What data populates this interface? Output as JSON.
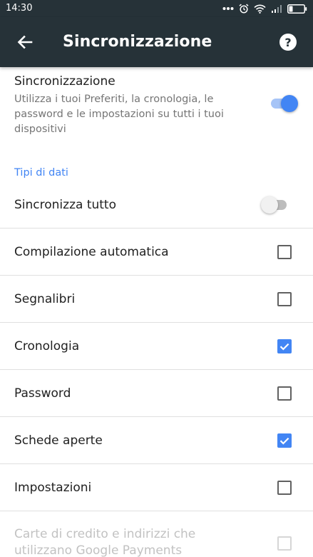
{
  "status_bar": {
    "time": "14:30"
  },
  "app_bar": {
    "title": "Sincronizzazione",
    "back_icon": "arrow-left-icon",
    "help_icon": "help-circle-icon"
  },
  "sync": {
    "title": "Sincronizzazione",
    "summary": "Utilizza i tuoi Preferiti, la cronologia, le password e le impostazioni su tutti i tuoi dispositivi",
    "enabled": true
  },
  "data_types": {
    "header": "Tipi di dati",
    "sync_all": {
      "label": "Sincronizza tutto",
      "enabled": false
    },
    "items": [
      {
        "label": "Compilazione automatica",
        "checked": false
      },
      {
        "label": "Segnalibri",
        "checked": false
      },
      {
        "label": "Cronologia",
        "checked": true
      },
      {
        "label": "Password",
        "checked": false
      },
      {
        "label": "Schede aperte",
        "checked": true
      },
      {
        "label": "Impostazioni",
        "checked": false
      }
    ],
    "payments": {
      "line1": "Carte di credito e indirizzi che",
      "line2": "utilizzano Google Payments",
      "checked": false,
      "disabled": true
    }
  },
  "colors": {
    "app_bar": "#263238",
    "accent": "#4285f4",
    "text_primary": "#212121",
    "text_secondary": "#757575",
    "divider": "#e0e0e0"
  }
}
